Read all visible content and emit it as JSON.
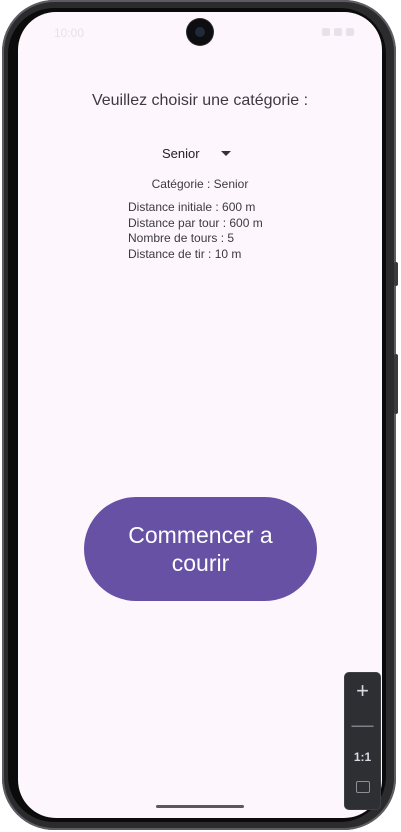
{
  "status": {
    "time": "10:00"
  },
  "title": "Veuillez choisir une catégorie :",
  "dropdown": {
    "selected": "Senior"
  },
  "selected_category": "Catégorie : Senior",
  "details": [
    "Distance initiale : 600 m",
    "Distance par tour : 600 m",
    "Nombre de tours : 5",
    "Distance de tir : 10 m"
  ],
  "start_button": {
    "label": "Commencer a courir"
  },
  "zoom_controls": {
    "plus": "+",
    "minus": "—",
    "actual_size": "1:1"
  },
  "colors": {
    "background": "#fdf6fd",
    "primary_button": "#6751a5"
  }
}
